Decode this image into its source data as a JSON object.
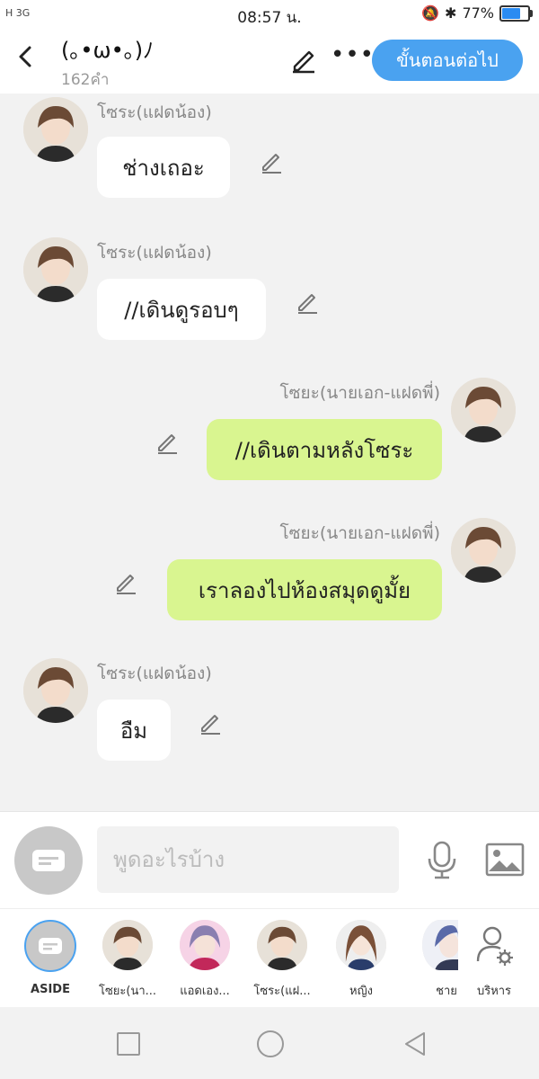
{
  "status": {
    "signal": "H 3G",
    "time": "08:57 น.",
    "battery": "77%",
    "battery_level": 0.77
  },
  "header": {
    "back_icon": "chevron-left-icon",
    "title": "(｡•ω•｡)ﾉ",
    "word_count": "162คำ",
    "next_button": "ขั้นตอนต่อไป"
  },
  "messages": [
    {
      "side": "left",
      "name": "โซระ(แฝดน้อง)",
      "text": "ช่างเถอะ"
    },
    {
      "side": "left",
      "name": "โซระ(แฝดน้อง)",
      "text": "//เดินดูรอบๆ"
    },
    {
      "side": "right",
      "name": "โซยะ(นายเอก-แฝดพี่)",
      "text": "//เดินตามหลังโซระ"
    },
    {
      "side": "right",
      "name": "โซยะ(นายเอก-แฝดพี่)",
      "text": "เราลองไปห้องสมุดดูมั้ย"
    },
    {
      "side": "left",
      "name": "โซระ(แฝดน้อง)",
      "text": "อืม"
    }
  ],
  "composer": {
    "placeholder": "พูดอะไรบ้าง"
  },
  "characters": [
    {
      "label": "ASIDE"
    },
    {
      "label": "โซยะ(นา..."
    },
    {
      "label": "แอดเอง..."
    },
    {
      "label": "โซระ(แฝ..."
    },
    {
      "label": "หญิง"
    },
    {
      "label": "ชาย"
    },
    {
      "label": "บริหาร"
    }
  ]
}
